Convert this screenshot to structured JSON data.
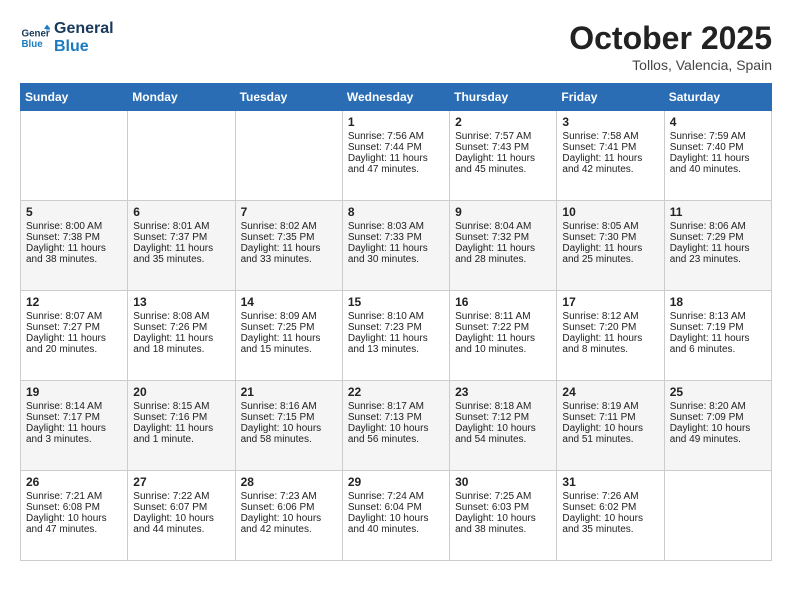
{
  "header": {
    "logo_line1": "General",
    "logo_line2": "Blue",
    "month": "October 2025",
    "location": "Tollos, Valencia, Spain"
  },
  "days_of_week": [
    "Sunday",
    "Monday",
    "Tuesday",
    "Wednesday",
    "Thursday",
    "Friday",
    "Saturday"
  ],
  "weeks": [
    [
      {
        "num": "",
        "sunrise": "",
        "sunset": "",
        "daylight": ""
      },
      {
        "num": "",
        "sunrise": "",
        "sunset": "",
        "daylight": ""
      },
      {
        "num": "",
        "sunrise": "",
        "sunset": "",
        "daylight": ""
      },
      {
        "num": "1",
        "sunrise": "Sunrise: 7:56 AM",
        "sunset": "Sunset: 7:44 PM",
        "daylight": "Daylight: 11 hours and 47 minutes."
      },
      {
        "num": "2",
        "sunrise": "Sunrise: 7:57 AM",
        "sunset": "Sunset: 7:43 PM",
        "daylight": "Daylight: 11 hours and 45 minutes."
      },
      {
        "num": "3",
        "sunrise": "Sunrise: 7:58 AM",
        "sunset": "Sunset: 7:41 PM",
        "daylight": "Daylight: 11 hours and 42 minutes."
      },
      {
        "num": "4",
        "sunrise": "Sunrise: 7:59 AM",
        "sunset": "Sunset: 7:40 PM",
        "daylight": "Daylight: 11 hours and 40 minutes."
      }
    ],
    [
      {
        "num": "5",
        "sunrise": "Sunrise: 8:00 AM",
        "sunset": "Sunset: 7:38 PM",
        "daylight": "Daylight: 11 hours and 38 minutes."
      },
      {
        "num": "6",
        "sunrise": "Sunrise: 8:01 AM",
        "sunset": "Sunset: 7:37 PM",
        "daylight": "Daylight: 11 hours and 35 minutes."
      },
      {
        "num": "7",
        "sunrise": "Sunrise: 8:02 AM",
        "sunset": "Sunset: 7:35 PM",
        "daylight": "Daylight: 11 hours and 33 minutes."
      },
      {
        "num": "8",
        "sunrise": "Sunrise: 8:03 AM",
        "sunset": "Sunset: 7:33 PM",
        "daylight": "Daylight: 11 hours and 30 minutes."
      },
      {
        "num": "9",
        "sunrise": "Sunrise: 8:04 AM",
        "sunset": "Sunset: 7:32 PM",
        "daylight": "Daylight: 11 hours and 28 minutes."
      },
      {
        "num": "10",
        "sunrise": "Sunrise: 8:05 AM",
        "sunset": "Sunset: 7:30 PM",
        "daylight": "Daylight: 11 hours and 25 minutes."
      },
      {
        "num": "11",
        "sunrise": "Sunrise: 8:06 AM",
        "sunset": "Sunset: 7:29 PM",
        "daylight": "Daylight: 11 hours and 23 minutes."
      }
    ],
    [
      {
        "num": "12",
        "sunrise": "Sunrise: 8:07 AM",
        "sunset": "Sunset: 7:27 PM",
        "daylight": "Daylight: 11 hours and 20 minutes."
      },
      {
        "num": "13",
        "sunrise": "Sunrise: 8:08 AM",
        "sunset": "Sunset: 7:26 PM",
        "daylight": "Daylight: 11 hours and 18 minutes."
      },
      {
        "num": "14",
        "sunrise": "Sunrise: 8:09 AM",
        "sunset": "Sunset: 7:25 PM",
        "daylight": "Daylight: 11 hours and 15 minutes."
      },
      {
        "num": "15",
        "sunrise": "Sunrise: 8:10 AM",
        "sunset": "Sunset: 7:23 PM",
        "daylight": "Daylight: 11 hours and 13 minutes."
      },
      {
        "num": "16",
        "sunrise": "Sunrise: 8:11 AM",
        "sunset": "Sunset: 7:22 PM",
        "daylight": "Daylight: 11 hours and 10 minutes."
      },
      {
        "num": "17",
        "sunrise": "Sunrise: 8:12 AM",
        "sunset": "Sunset: 7:20 PM",
        "daylight": "Daylight: 11 hours and 8 minutes."
      },
      {
        "num": "18",
        "sunrise": "Sunrise: 8:13 AM",
        "sunset": "Sunset: 7:19 PM",
        "daylight": "Daylight: 11 hours and 6 minutes."
      }
    ],
    [
      {
        "num": "19",
        "sunrise": "Sunrise: 8:14 AM",
        "sunset": "Sunset: 7:17 PM",
        "daylight": "Daylight: 11 hours and 3 minutes."
      },
      {
        "num": "20",
        "sunrise": "Sunrise: 8:15 AM",
        "sunset": "Sunset: 7:16 PM",
        "daylight": "Daylight: 11 hours and 1 minute."
      },
      {
        "num": "21",
        "sunrise": "Sunrise: 8:16 AM",
        "sunset": "Sunset: 7:15 PM",
        "daylight": "Daylight: 10 hours and 58 minutes."
      },
      {
        "num": "22",
        "sunrise": "Sunrise: 8:17 AM",
        "sunset": "Sunset: 7:13 PM",
        "daylight": "Daylight: 10 hours and 56 minutes."
      },
      {
        "num": "23",
        "sunrise": "Sunrise: 8:18 AM",
        "sunset": "Sunset: 7:12 PM",
        "daylight": "Daylight: 10 hours and 54 minutes."
      },
      {
        "num": "24",
        "sunrise": "Sunrise: 8:19 AM",
        "sunset": "Sunset: 7:11 PM",
        "daylight": "Daylight: 10 hours and 51 minutes."
      },
      {
        "num": "25",
        "sunrise": "Sunrise: 8:20 AM",
        "sunset": "Sunset: 7:09 PM",
        "daylight": "Daylight: 10 hours and 49 minutes."
      }
    ],
    [
      {
        "num": "26",
        "sunrise": "Sunrise: 7:21 AM",
        "sunset": "Sunset: 6:08 PM",
        "daylight": "Daylight: 10 hours and 47 minutes."
      },
      {
        "num": "27",
        "sunrise": "Sunrise: 7:22 AM",
        "sunset": "Sunset: 6:07 PM",
        "daylight": "Daylight: 10 hours and 44 minutes."
      },
      {
        "num": "28",
        "sunrise": "Sunrise: 7:23 AM",
        "sunset": "Sunset: 6:06 PM",
        "daylight": "Daylight: 10 hours and 42 minutes."
      },
      {
        "num": "29",
        "sunrise": "Sunrise: 7:24 AM",
        "sunset": "Sunset: 6:04 PM",
        "daylight": "Daylight: 10 hours and 40 minutes."
      },
      {
        "num": "30",
        "sunrise": "Sunrise: 7:25 AM",
        "sunset": "Sunset: 6:03 PM",
        "daylight": "Daylight: 10 hours and 38 minutes."
      },
      {
        "num": "31",
        "sunrise": "Sunrise: 7:26 AM",
        "sunset": "Sunset: 6:02 PM",
        "daylight": "Daylight: 10 hours and 35 minutes."
      },
      {
        "num": "",
        "sunrise": "",
        "sunset": "",
        "daylight": ""
      }
    ]
  ]
}
